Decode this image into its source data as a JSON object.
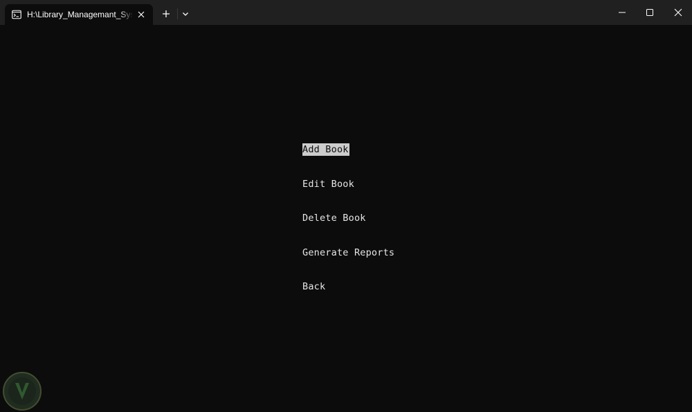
{
  "window": {
    "tab_title": "H:\\Library_Managemant_System",
    "tab_icon": "terminal-icon",
    "new_tab_icon": "plus-icon",
    "dropdown_icon": "chevron-down-icon",
    "controls": [
      "minimize-icon",
      "maximize-icon",
      "close-icon"
    ]
  },
  "menu": {
    "selected_index": 0,
    "items": [
      {
        "label": "Add Book"
      },
      {
        "label": "Edit Book"
      },
      {
        "label": "Delete Book"
      },
      {
        "label": "Generate Reports"
      },
      {
        "label": "Back"
      }
    ]
  },
  "colors": {
    "background": "#0c0c0c",
    "titlebar": "#202020",
    "text": "#e6e6e6",
    "selection_bg": "#cccccc",
    "selection_fg": "#0c0c0c"
  }
}
